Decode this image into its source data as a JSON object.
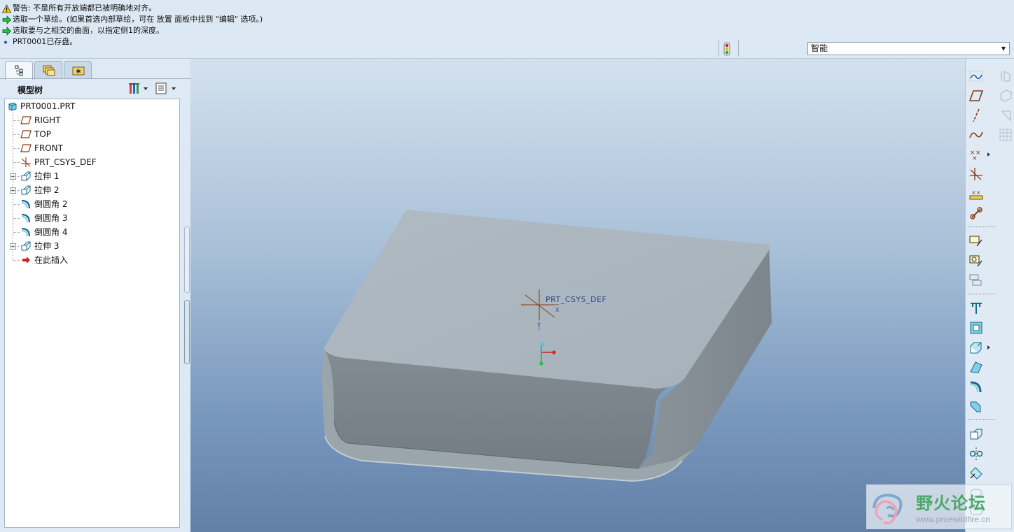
{
  "messages": [
    {
      "icon": "warning-icon",
      "text": "警告: 不是所有开放端都已被明确地对齐。"
    },
    {
      "icon": "green-arrow-icon",
      "text": "选取一个草绘。(如果首选内部草绘，可在 放置 面板中找到 \"编辑\" 选项。)"
    },
    {
      "icon": "green-arrow-icon",
      "text": "选取要与之相交的曲面，以指定侧1的深度。"
    },
    {
      "icon": "blue-dot-icon",
      "text": "PRT0001已存盘。"
    }
  ],
  "filter": {
    "selected": "智能"
  },
  "model_tree": {
    "title": "模型树",
    "items": [
      {
        "label": "PRT0001.PRT",
        "icon": "part-icon",
        "expandable": false
      },
      {
        "label": "RIGHT",
        "icon": "datum-plane-icon",
        "expandable": false
      },
      {
        "label": "TOP",
        "icon": "datum-plane-icon",
        "expandable": false
      },
      {
        "label": "FRONT",
        "icon": "datum-plane-icon",
        "expandable": false
      },
      {
        "label": "PRT_CSYS_DEF",
        "icon": "csys-icon",
        "expandable": false
      },
      {
        "label": "拉伸 1",
        "icon": "extrude-icon",
        "expandable": true
      },
      {
        "label": "拉伸 2",
        "icon": "extrude-icon",
        "expandable": true
      },
      {
        "label": "倒圆角 2",
        "icon": "round-icon",
        "expandable": false
      },
      {
        "label": "倒圆角 3",
        "icon": "round-icon",
        "expandable": false
      },
      {
        "label": "倒圆角 4",
        "icon": "round-icon",
        "expandable": false
      },
      {
        "label": "拉伸 3",
        "icon": "extrude-icon",
        "expandable": true
      },
      {
        "label": "在此插入",
        "icon": "insert-here-arrow-icon",
        "expandable": false
      }
    ]
  },
  "viewport": {
    "csys_label": "PRT_CSYS_DEF",
    "csys_axis_x": "X",
    "csys_axis_y": "Y"
  },
  "watermark": {
    "text": "野火论坛",
    "url": "www.proewildfire.cn"
  },
  "colors": {
    "datum": "#8a3a10",
    "accent_green": "#1aa34a",
    "model_top": "#a9b5bd",
    "model_side": "#7d868b"
  }
}
